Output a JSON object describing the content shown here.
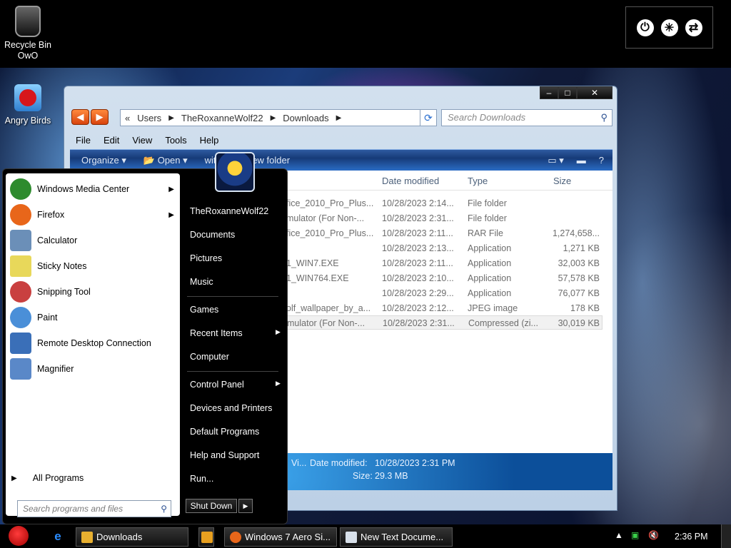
{
  "desktop": {
    "recycle_bin": "Recycle Bin OwO",
    "angry_birds": "Angry Birds"
  },
  "explorer": {
    "caption": {
      "minimize": "–",
      "maximize": "□",
      "close": "✕"
    },
    "breadcrumb": {
      "prefix": "«",
      "items": [
        "Users",
        "TheRoxanneWolf22",
        "Downloads"
      ]
    },
    "search_placeholder": "Search Downloads",
    "menu": [
      "File",
      "Edit",
      "View",
      "Tools",
      "Help"
    ],
    "toolbar": {
      "organize": "Organize",
      "open": "Open",
      "with": "with",
      "new_folder": "New folder"
    },
    "columns": {
      "date": "Date modified",
      "type": "Type",
      "size": "Size"
    },
    "rows": [
      {
        "name": "fice_2010_Pro_Plus...",
        "date": "10/28/2023 2:14...",
        "type": "File folder",
        "size": ""
      },
      {
        "name": "mulator (For Non-...",
        "date": "10/28/2023 2:31...",
        "type": "File folder",
        "size": ""
      },
      {
        "name": "fice_2010_Pro_Plus...",
        "date": "10/28/2023 2:11...",
        "type": "RAR File",
        "size": "1,274,658..."
      },
      {
        "name": "",
        "date": "10/28/2023 2:13...",
        "type": "Application",
        "size": "1,271 KB"
      },
      {
        "name": "1_WIN7.EXE",
        "date": "10/28/2023 2:11...",
        "type": "Application",
        "size": "32,003 KB"
      },
      {
        "name": "1_WIN764.EXE",
        "date": "10/28/2023 2:10...",
        "type": "Application",
        "size": "57,578 KB"
      },
      {
        "name": "",
        "date": "10/28/2023 2:29...",
        "type": "Application",
        "size": "76,077 KB"
      },
      {
        "name": "olf_wallpaper_by_a...",
        "date": "10/28/2023 2:12...",
        "type": "JPEG image",
        "size": "178 KB"
      },
      {
        "name": "mulator (For Non-...",
        "date": "10/28/2023 2:31...",
        "type": "Compressed (zi...",
        "size": "30,019 KB"
      }
    ],
    "details": {
      "name_frag": "Vi...",
      "date_label": "Date modified:",
      "date_value": "10/28/2023 2:31 PM",
      "size_label": "Size:",
      "size_value": "29.3 MB"
    }
  },
  "start_menu": {
    "programs": [
      {
        "label": "Windows Media Center",
        "icon": "windows-media-center-icon",
        "arrow": true,
        "color": "#2e8b2e"
      },
      {
        "label": "Firefox",
        "icon": "firefox-icon",
        "arrow": true,
        "color": "#e8661a"
      },
      {
        "label": "Calculator",
        "icon": "calculator-icon",
        "arrow": false,
        "color": "#6b8fb8"
      },
      {
        "label": "Sticky Notes",
        "icon": "sticky-notes-icon",
        "arrow": false,
        "color": "#e8d85a"
      },
      {
        "label": "Snipping Tool",
        "icon": "snipping-tool-icon",
        "arrow": false,
        "color": "#c94040"
      },
      {
        "label": "Paint",
        "icon": "paint-icon",
        "arrow": false,
        "color": "#4a8fd8"
      },
      {
        "label": "Remote Desktop Connection",
        "icon": "remote-desktop-icon",
        "arrow": false,
        "color": "#3a6fb8"
      },
      {
        "label": "Magnifier",
        "icon": "magnifier-icon",
        "arrow": false,
        "color": "#5a88c8"
      }
    ],
    "all_programs": "All Programs",
    "search_placeholder": "Search programs and files",
    "right_links": [
      "TheRoxanneWolf22",
      "Documents",
      "Pictures",
      "Music",
      "Games",
      "Recent Items",
      "Computer",
      "Control Panel",
      "Devices and Printers",
      "Default Programs",
      "Help and Support",
      "Run..."
    ],
    "shutdown": "Shut Down"
  },
  "taskbar": {
    "buttons": [
      {
        "label": "Downloads",
        "icon_color": "#e8b030"
      },
      {
        "label": "Windows 7 Aero Si...",
        "icon_color": "#e8661a"
      },
      {
        "label": "New Text Docume...",
        "icon_color": "#d8e0ea"
      }
    ],
    "clock": "2:36 PM"
  }
}
